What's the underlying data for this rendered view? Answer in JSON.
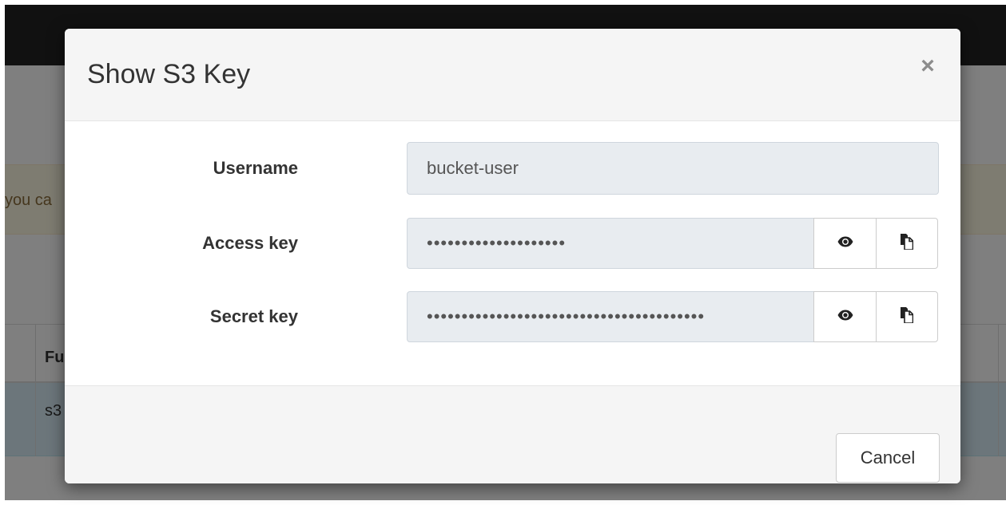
{
  "background": {
    "alert_text": "you ca",
    "table_header_fragment": "Fu",
    "table_cell_fragment": "s3"
  },
  "modal": {
    "title": "Show S3 Key",
    "close_symbol": "×",
    "fields": {
      "username": {
        "label": "Username",
        "value": "bucket-user"
      },
      "access_key": {
        "label": "Access key",
        "value": "••••••••••••••••••••"
      },
      "secret_key": {
        "label": "Secret key",
        "value": "••••••••••••••••••••••••••••••••••••••••"
      }
    },
    "icons": {
      "reveal": "eye-icon",
      "copy": "clipboard-icon"
    },
    "cancel_label": "Cancel"
  }
}
